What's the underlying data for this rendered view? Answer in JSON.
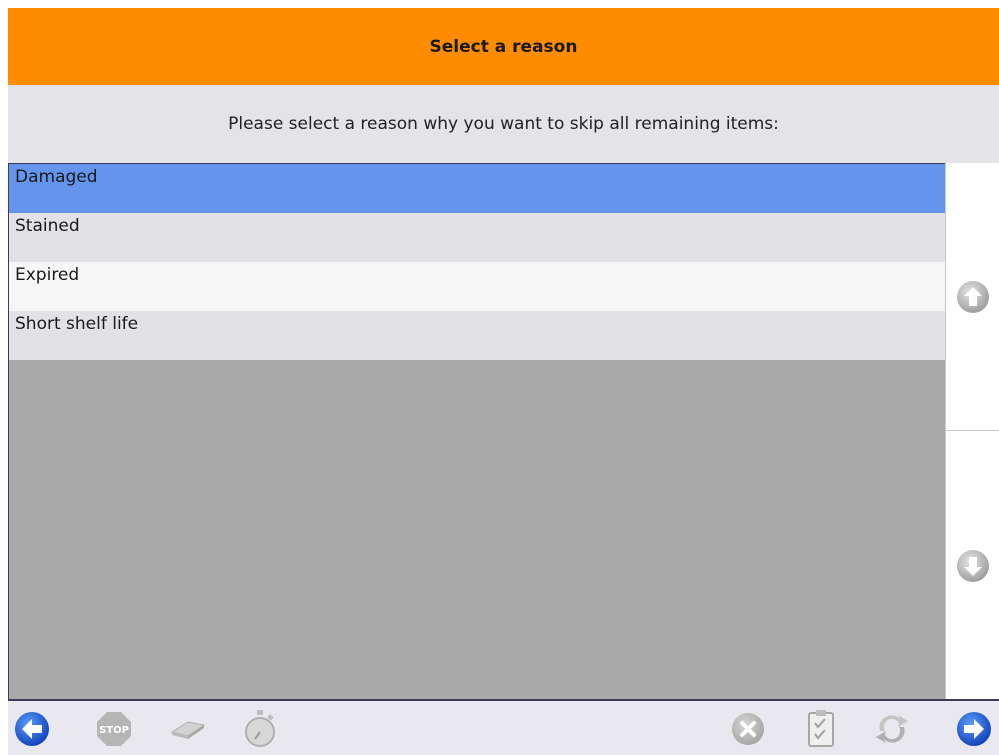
{
  "header": {
    "title": "Select a reason"
  },
  "prompt": {
    "text": "Please select a reason why you want to skip all remaining items:"
  },
  "reasons": [
    {
      "label": "Damaged",
      "selected": true
    },
    {
      "label": "Stained",
      "selected": false
    },
    {
      "label": "Expired",
      "selected": false
    },
    {
      "label": "Short shelf life",
      "selected": false
    }
  ],
  "scroll": {
    "up_icon": "arrow-up-icon",
    "down_icon": "arrow-down-icon"
  },
  "toolbar": {
    "back_icon": "arrow-left-icon",
    "stop_label": "STOP",
    "eraser_icon": "eraser-icon",
    "timer_icon": "stopwatch-icon",
    "cancel_icon": "close-icon",
    "checklist_icon": "checklist-icon",
    "refresh_icon": "refresh-icon",
    "forward_icon": "arrow-right-icon"
  },
  "colors": {
    "header": "#ff8c00",
    "selected_row": "#6495ed",
    "nav_blue": "#1e5fd8",
    "disabled_grey": "#bdbdbd"
  }
}
